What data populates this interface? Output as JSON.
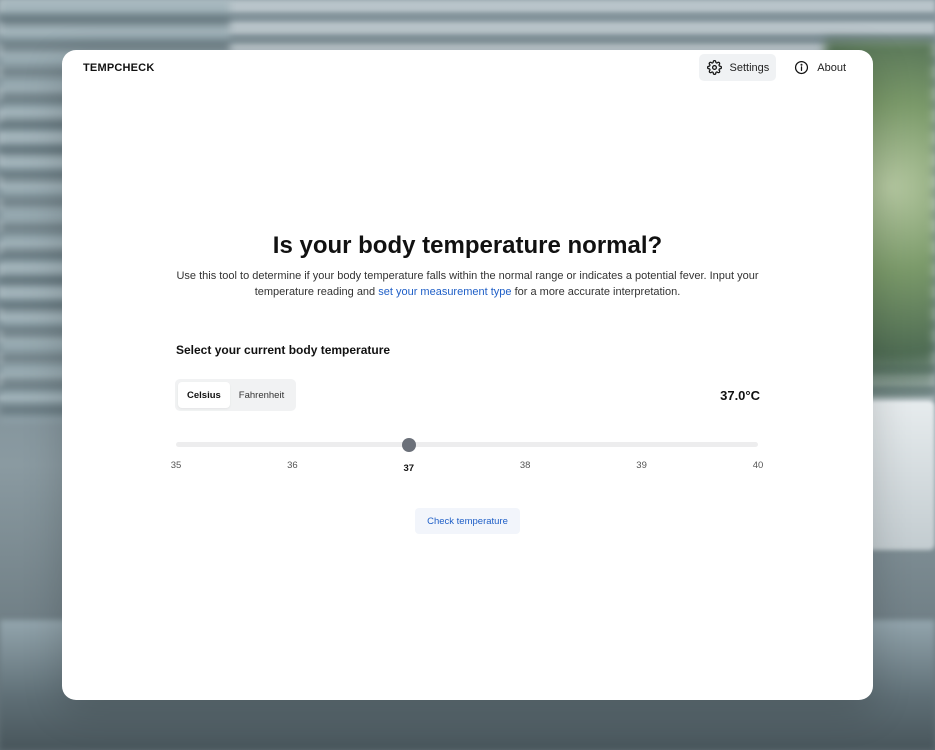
{
  "app": {
    "brand": "TEMPCHECK"
  },
  "nav": {
    "settings": {
      "label": "Settings",
      "icon": "gear-icon"
    },
    "about": {
      "label": "About",
      "icon": "info-icon"
    }
  },
  "hero": {
    "title": "Is your body temperature normal?",
    "description_before": "Use this tool to determine if your body temperature falls within the normal range or indicates a potential fever. Input your temperature reading and ",
    "description_link": "set your measurement type",
    "description_after": " for a more accurate interpretation."
  },
  "form": {
    "section_label": "Select your current body temperature",
    "units": [
      {
        "label": "Celsius",
        "active": true
      },
      {
        "label": "Fahrenheit",
        "active": false
      }
    ],
    "reading": "37.0°C",
    "slider": {
      "min": 35,
      "max": 40,
      "value": 37.0,
      "ticks": [
        "35",
        "36",
        "37",
        "38",
        "39",
        "40"
      ]
    },
    "submit_label": "Check temperature"
  },
  "colors": {
    "accent": "#1f5fc7",
    "thumb": "#6b7079",
    "track": "#ededee"
  }
}
